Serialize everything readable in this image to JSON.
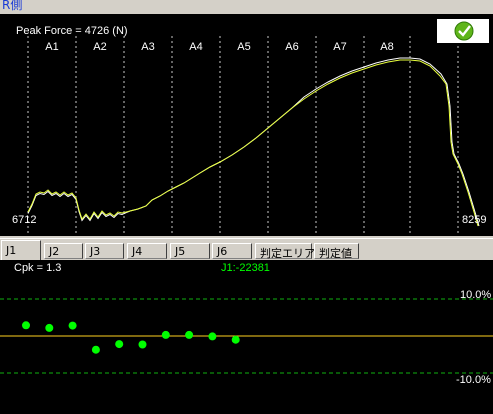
{
  "window": {
    "title_fragment": "R側"
  },
  "top_chart": {
    "peak_label": "Peak Force = 4726 (N)",
    "zones": [
      "A1",
      "A2",
      "A3",
      "A4",
      "A5",
      "A6",
      "A7",
      "A8"
    ],
    "left_value": "6712",
    "right_value": "8259",
    "ok_icon": "ok-check-icon",
    "colors": {
      "curve": "#e8ff3c",
      "curve2": "#ffffff",
      "background": "#000000",
      "zone_lines": "#c8c8c8"
    }
  },
  "tabs": [
    {
      "label": "J1",
      "active": true
    },
    {
      "label": "J2"
    },
    {
      "label": "J3"
    },
    {
      "label": "J4"
    },
    {
      "label": "J5"
    },
    {
      "label": "J6"
    },
    {
      "label": "判定エリア"
    },
    {
      "label": "判定値"
    }
  ],
  "bottom_chart": {
    "cpk_label": "Cpk = 1.3",
    "series_label": "J1:-22381",
    "upper_limit_label": "10.0%",
    "lower_limit_label": "-10.0%",
    "colors": {
      "points": "#00ff00",
      "center_line": "#ffd21f",
      "limit_lines": "#10b010"
    }
  },
  "chart_data": {
    "type": "scatter",
    "title": "J1:-22381",
    "ylim": [
      -10,
      10
    ],
    "y_tick_labels": [
      "10.0%",
      "-10.0%"
    ],
    "points": [
      {
        "x": 1,
        "y": 2.9
      },
      {
        "x": 2,
        "y": 2.2
      },
      {
        "x": 3,
        "y": 2.8
      },
      {
        "x": 4,
        "y": -3.7
      },
      {
        "x": 5,
        "y": -2.2
      },
      {
        "x": 6,
        "y": -2.3
      },
      {
        "x": 7,
        "y": 0.3
      },
      {
        "x": 8,
        "y": 0.3
      },
      {
        "x": 9,
        "y": -0.1
      },
      {
        "x": 10,
        "y": -1.0
      }
    ]
  }
}
